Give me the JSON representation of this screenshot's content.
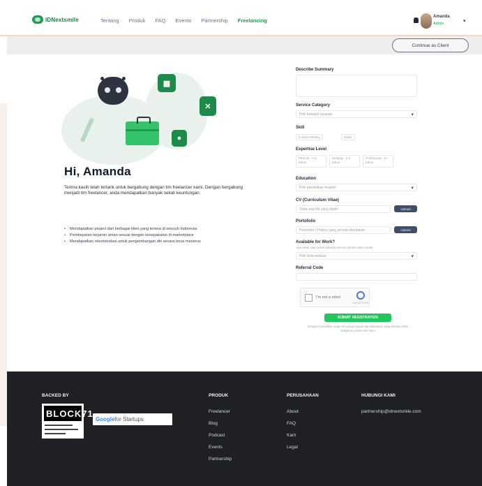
{
  "header": {
    "logo_text": "IDNextsmile",
    "nav": [
      "Tentang",
      "Produk",
      "FAQ",
      "Events",
      "Partnership",
      "Freelancing"
    ],
    "active_nav": "Freelancing",
    "user_name": "Amanda",
    "user_role": "Admin"
  },
  "subbar": {
    "button_label": "Continue as Client"
  },
  "hero": {
    "greeting": "Hi, Amanda",
    "intro": "Terima kasih telah tertarik untuk bergabung dengan tim freelancer kami. Dengan bergabung menjadi tim freelancer, anda mendapatkan banyak sekali keuntungan.",
    "bullets": [
      "Mendapatkan project dari berbagai klien yang tertera di seluruh Indonesia",
      "Pembayaran terjamin aman sesuai dengan kesepakatan di marketplace",
      "Mendapatkan rekomendasi untuk pengembangan diri secara terus menerus"
    ]
  },
  "form": {
    "summary_label": "Describe Summary",
    "category_label": "Service Category",
    "category_value": "Pilih kategori layanan",
    "skill_label": "Skill",
    "skills": [
      "Content Writing",
      "Editor"
    ],
    "expertise_label": "Expertise Level",
    "expertise": [
      "Pemula - 0-1 tahun",
      "Sedang - 2-4 tahun",
      "Profesional - 5+ tahun"
    ],
    "education_label": "Education",
    "education_value": "Pilih pendidikan terakhir",
    "cv_label": "CV (Curriculum Vitae)",
    "cv_value": "Tidak ada file yang dipilih",
    "cv_button": "Upload",
    "portfolio_label": "Portofolio",
    "portfolio_value": "Portofolio / Project yang pernah dikerjakan",
    "portfolio_button": "Upload",
    "available_label": "Available for Work?",
    "available_sub": "Apa anda siap untuk bekerja secara remote atau onsite",
    "available_value": "Pilih ketersediaan",
    "referral_label": "Referral Code",
    "captcha_text": "I'm not a robot",
    "captcha_brand": "reCAPTCHA",
    "submit_label": "SUBMIT REGISTRATION",
    "terms": "Dengan mendaftar, anda menyetujui syarat dan ketentuan yang berlaku serta kebijakan privasi dari kami"
  },
  "footer": {
    "partner_title": "BACKED BY",
    "partner_badge": "BLOCK71",
    "google_label_prefix": "Google",
    "google_label_suffix": " for Startups",
    "products_title": "PRODUK",
    "products": [
      "Freelancer",
      "Blog",
      "Podcast",
      "Events",
      "Partnership"
    ],
    "company_title": "PERUSAHAAN",
    "company": [
      "About",
      "FAQ",
      "Karir",
      "Legal"
    ],
    "contact_title": "HUBUNGI KAMI",
    "contact_email": "partnership@idnextsmile.com"
  },
  "colors": {
    "brand_green": "#1b8a4b",
    "accent_green": "#22c55e",
    "footer_bg": "#1f2024",
    "header_border": "#f3d8c9"
  }
}
